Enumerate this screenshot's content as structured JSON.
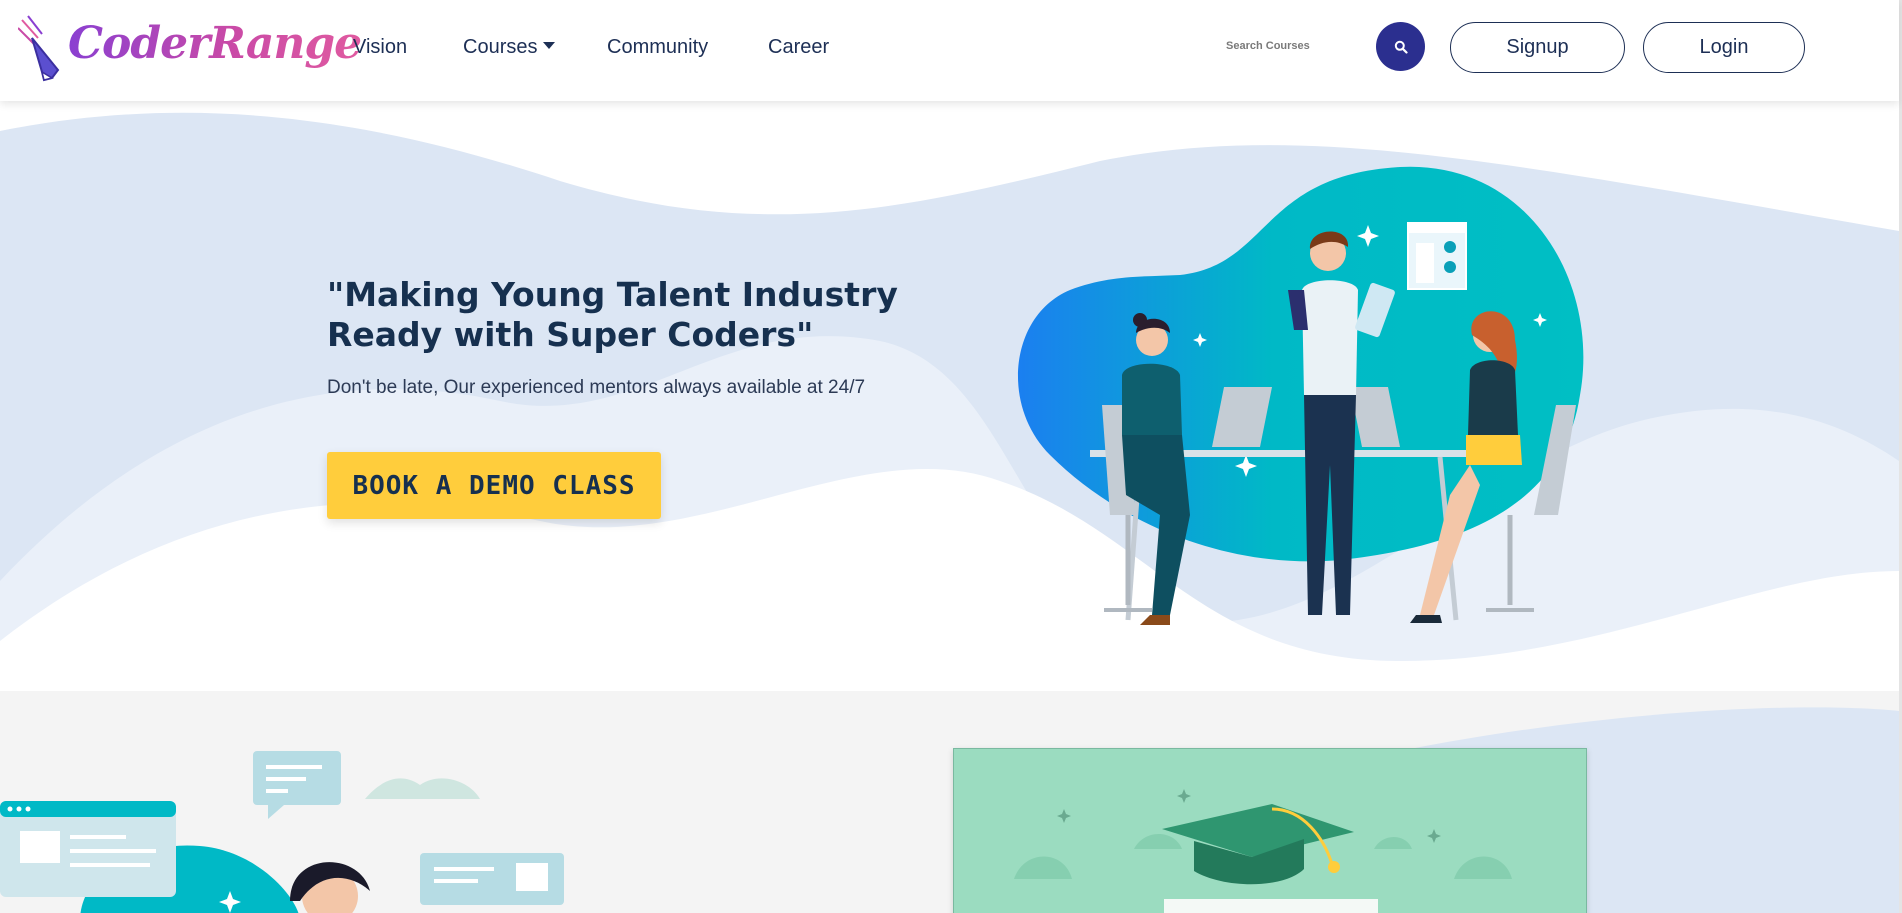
{
  "brand": {
    "name": "CoderRange"
  },
  "nav": {
    "items": [
      "Vision",
      "Courses",
      "Community",
      "Career"
    ]
  },
  "search": {
    "placeholder": "Search Courses",
    "icon": "search-icon"
  },
  "auth": {
    "signup_label": "Signup",
    "login_label": "Login"
  },
  "hero": {
    "title": "\"Making Young Talent Industry Ready with Super Coders\"",
    "subtitle": "Don't be late, Our experienced mentors always available at 24/7",
    "cta_label": "BOOK A DEMO CLASS",
    "illustration": "team-working-illustration"
  },
  "section2": {
    "left_illustration": "chat-learning-illustration",
    "card_illustration": "graduation-cap-illustration"
  },
  "colors": {
    "navy": "#1d2f55",
    "search_button": "#2b2f8f",
    "cta": "#ffcd3c",
    "teal": "#00b9c6",
    "hero_wave": "#dce6f4",
    "card_green": "#9bdcc0"
  }
}
